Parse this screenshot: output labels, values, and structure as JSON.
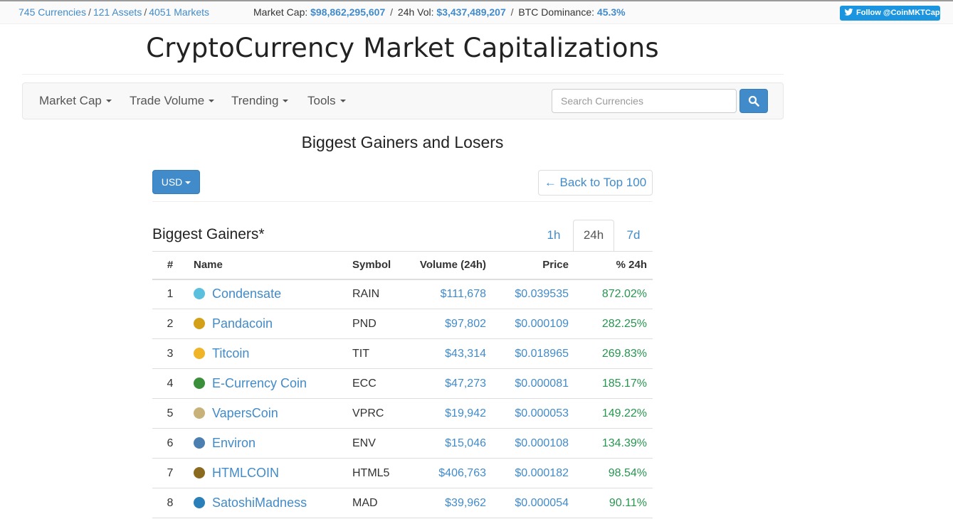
{
  "topbar": {
    "currencies": "745 Currencies",
    "assets": "121 Assets",
    "markets": "4051 Markets",
    "market_cap_label": "Market Cap:",
    "market_cap_value": "$98,862,295,607",
    "volume_label": "24h Vol:",
    "volume_value": "$3,437,489,207",
    "dominance_label": "BTC Dominance:",
    "dominance_value": "45.3%",
    "follow_label": "Follow @CoinMKTCap"
  },
  "header": {
    "title": "CryptoCurrency Market Capitalizations"
  },
  "nav": {
    "items": [
      "Market Cap",
      "Trade Volume",
      "Trending",
      "Tools"
    ],
    "search_placeholder": "Search Currencies"
  },
  "page": {
    "heading": "Biggest Gainers and Losers",
    "currency_selected": "USD",
    "back_label": "← Back to Top 100",
    "section_title": "Biggest Gainers*"
  },
  "tabs": [
    {
      "label": "1h",
      "active": false
    },
    {
      "label": "24h",
      "active": true
    },
    {
      "label": "7d",
      "active": false
    }
  ],
  "table": {
    "headers": {
      "rank": "#",
      "name": "Name",
      "symbol": "Symbol",
      "volume": "Volume (24h)",
      "price": "Price",
      "change": "% 24h"
    },
    "rows": [
      {
        "rank": "1",
        "name": "Condensate",
        "symbol": "RAIN",
        "volume": "$111,678",
        "price": "$0.039535",
        "change": "872.02%",
        "icon": "cloud-rain-icon",
        "color": "#5bc0de"
      },
      {
        "rank": "2",
        "name": "Pandacoin",
        "symbol": "PND",
        "volume": "$97,802",
        "price": "$0.000109",
        "change": "282.25%",
        "icon": "panda-coin-icon",
        "color": "#d4a017"
      },
      {
        "rank": "3",
        "name": "Titcoin",
        "symbol": "TIT",
        "volume": "$43,314",
        "price": "$0.018965",
        "change": "269.83%",
        "icon": "gold-coin-icon",
        "color": "#f0b429"
      },
      {
        "rank": "4",
        "name": "E-Currency Coin",
        "symbol": "ECC",
        "volume": "$47,273",
        "price": "$0.000081",
        "change": "185.17%",
        "icon": "green-coin-icon",
        "color": "#3a8f3a"
      },
      {
        "rank": "5",
        "name": "VapersCoin",
        "symbol": "VPRC",
        "volume": "$19,942",
        "price": "$0.000053",
        "change": "149.22%",
        "icon": "vapers-coin-icon",
        "color": "#c8b27a"
      },
      {
        "rank": "6",
        "name": "Environ",
        "symbol": "ENV",
        "volume": "$15,046",
        "price": "$0.000108",
        "change": "134.39%",
        "icon": "globe-coin-icon",
        "color": "#4a7fb0"
      },
      {
        "rank": "7",
        "name": "HTMLCOIN",
        "symbol": "HTML5",
        "volume": "$406,763",
        "price": "$0.000182",
        "change": "98.54%",
        "icon": "html-coin-icon",
        "color": "#8a6a1f"
      },
      {
        "rank": "8",
        "name": "SatoshiMadness",
        "symbol": "MAD",
        "volume": "$39,962",
        "price": "$0.000054",
        "change": "90.11%",
        "icon": "satoshi-madness-icon",
        "color": "#2a7fb8"
      }
    ]
  },
  "colors": {
    "link": "#428bca",
    "positive": "#27964f",
    "twitter": "#1b95e0"
  }
}
